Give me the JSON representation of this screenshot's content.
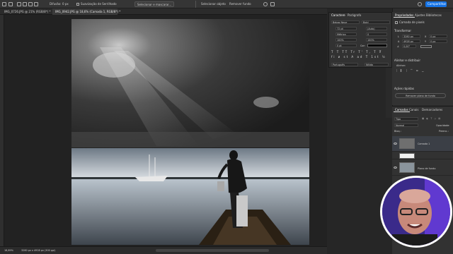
{
  "options_bar": {
    "difuso_label": "Difusão:",
    "difuso_value": "0 px",
    "anti_alias_label": "Suavização de Serrilhado",
    "select_mask_label": "Selecionar e mascarar...",
    "select_subject_label": "Selecionar objeto",
    "remove_bg_label": "Remover fundo",
    "share_label": "Compartilhar"
  },
  "tabs": [
    {
      "label": "IMG_0726.JPG @ 21% (RGB/8*) *"
    },
    {
      "label": "IMG_0942.JPG @ 18,6% (Camada 1, RGB/8*) *"
    }
  ],
  "status": {
    "zoom": "18,89%",
    "dims": "3280 px x 4928 px (300 ppi)"
  },
  "char_panel": {
    "tabs": [
      "Caractere",
      "Parágrafo"
    ],
    "font_family": "Bebas Neue",
    "font_style": "Bold",
    "font_size": "72 pt",
    "leading": "(Auto)",
    "kerning": "Métrica",
    "tracking": "0",
    "vscale": "100%",
    "hscale": "100%",
    "baseline": "0 pt",
    "color_label": "Cor:",
    "language": "Português",
    "aa": "Nítido"
  },
  "props_panel": {
    "tabs": [
      "Propriedades",
      "Ajustes",
      "Bibliotecas"
    ],
    "layer_type": "Camada de pixels",
    "transform_title": "Transformar",
    "w": "3280 px",
    "h": "4928 px",
    "x": "0 px",
    "y": "0 px",
    "angle": "0,00°",
    "align_title": "Alinhar e distribuir",
    "align_label": "Alinhar:",
    "quick_title": "Ações rápidas",
    "remove_bg_btn": "Remover plano de fundo"
  },
  "layers_panel": {
    "tabs": [
      "Camadas",
      "Canais",
      "Demarcadores"
    ],
    "kind": "Tipo",
    "blend": "Normal",
    "opacity_label": "Opacidade:",
    "fill_label": "Preenc.:",
    "lock_label": "Bloq.:",
    "layers": [
      {
        "name": "Camada 1"
      },
      {
        "name": "Plano de fundo"
      }
    ]
  },
  "colors": {
    "accent": "#1473e6",
    "panel": "#323232",
    "canvas": "#222222"
  }
}
